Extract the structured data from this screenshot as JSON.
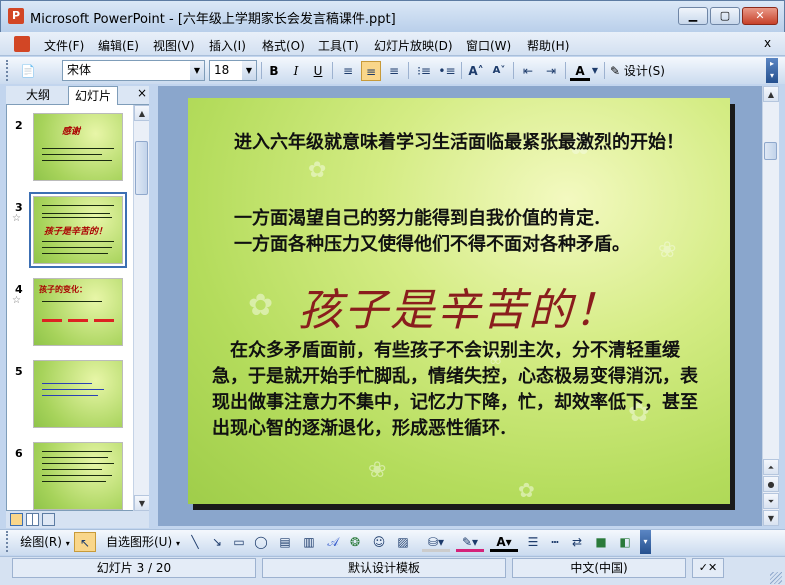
{
  "window": {
    "title": "Microsoft PowerPoint - [六年级上学期家长会发言稿课件.ppt]",
    "app_icon": "P",
    "minimize_icon": "minimize-icon",
    "maximize_icon": "maximize-icon",
    "close_icon": "close-icon"
  },
  "menu": {
    "items": [
      "文件(F)",
      "编辑(E)",
      "视图(V)",
      "插入(I)",
      "格式(O)",
      "工具(T)",
      "幻灯片放映(D)",
      "窗口(W)",
      "帮助(H)"
    ],
    "close_doc": "x"
  },
  "toolbar": {
    "font_name": "宋体",
    "font_size": "18",
    "bold": "B",
    "italic": "I",
    "underline": "U",
    "font_color_label": "A",
    "design_label": "设计(S)"
  },
  "left_panel": {
    "tabs": [
      "大纲",
      "幻灯片"
    ],
    "close": "×",
    "thumbnails": [
      {
        "number": "2",
        "title": "感谢",
        "star": ""
      },
      {
        "number": "3",
        "title": "孩子是辛苦的！",
        "star": "☆",
        "selected": true
      },
      {
        "number": "4",
        "title": "孩子的变化：",
        "star": "☆"
      },
      {
        "number": "5",
        "title": "",
        "star": ""
      },
      {
        "number": "6",
        "title": "",
        "star": ""
      }
    ]
  },
  "slide": {
    "para1": "进入六年级就意味着学习生活面临最紧张最激烈的开始！",
    "para2a": "一方面渴望自己的努力能得到自我价值的肯定.",
    "para2b": "一方面各种压力又使得他们不得不面对各种矛盾。",
    "headline": "孩子是辛苦的！",
    "para3": "在众多矛盾面前，有些孩子不会识别主次，分不清轻重缓急，于是就开始手忙脚乱，情绪失控，心态极易变得消沉，表现出做事注意力不集中，记忆力下降，忙，却效率低下，甚至出现心智的逐渐退化，形成恶性循环."
  },
  "drawing_toolbar": {
    "draw_label": "绘图(R)",
    "autoshapes_label": "自选图形(U)"
  },
  "status": {
    "slide_info": "幻灯片 3 / 20",
    "template": "默认设计模板",
    "language": "中文(中国)"
  }
}
